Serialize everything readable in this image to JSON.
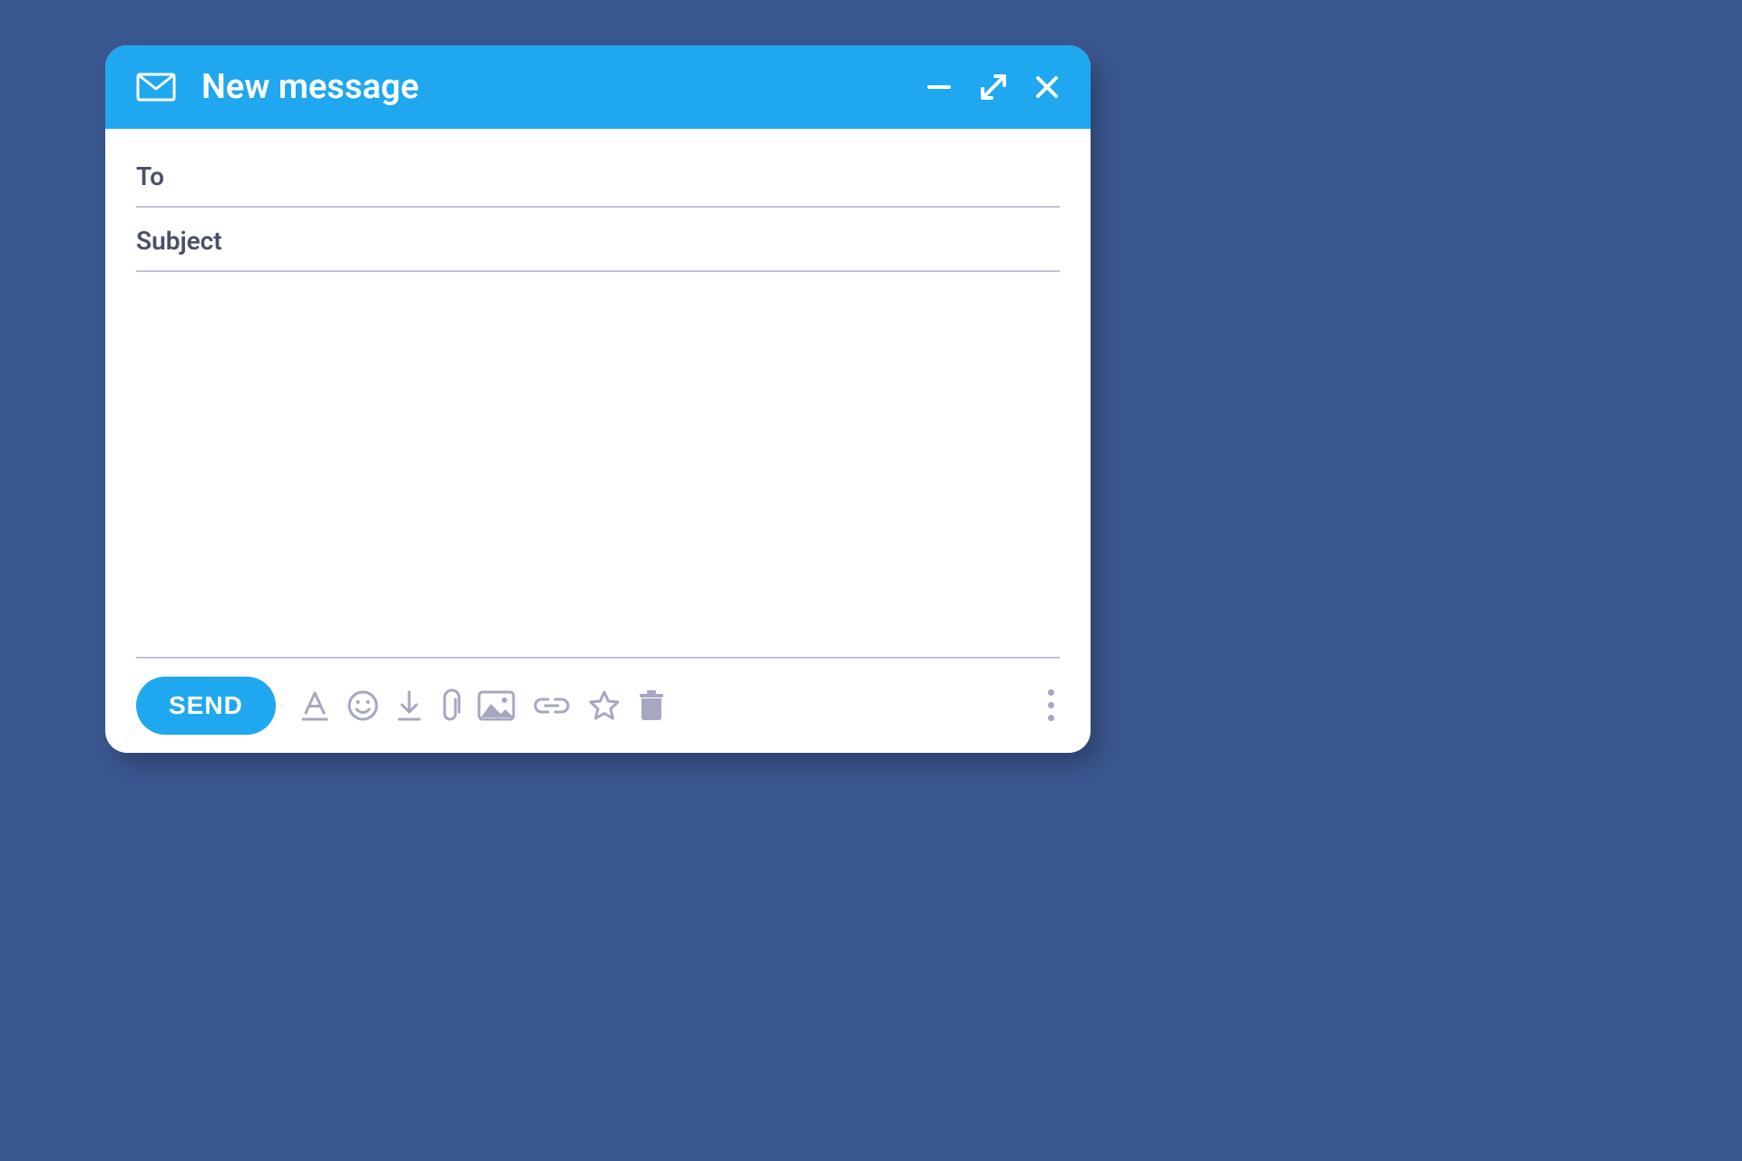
{
  "header": {
    "title": "New message"
  },
  "fields": {
    "to_label": "To",
    "subject_label": "Subject"
  },
  "footer": {
    "send_label": "SEND"
  },
  "colors": {
    "background": "#3b5891",
    "accent": "#1fa8ef",
    "muted_icon": "#a4a8c0",
    "field_label": "#4a5066",
    "divider": "#c1c2d2"
  }
}
